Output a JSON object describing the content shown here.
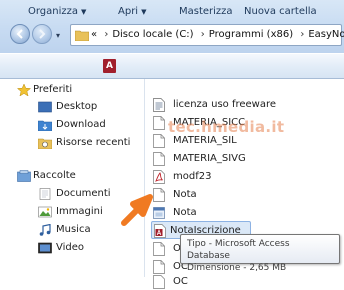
{
  "address": {
    "chevrons": "«",
    "crumbs": [
      "Disco locale (C:)",
      "Programmi (x86)",
      "EasyNota"
    ],
    "separator": "›"
  },
  "toolbar": {
    "organizza": "Organizza",
    "apri": "Apri",
    "masterizza": "Masterizza",
    "nuova_cartella": "Nuova cartella"
  },
  "nav": {
    "favorites_header": "Preferiti",
    "favorites": [
      "Desktop",
      "Download",
      "Risorse recenti"
    ],
    "libraries_header": "Raccolte",
    "libraries": [
      "Documenti",
      "Immagini",
      "Musica",
      "Video"
    ]
  },
  "files": [
    {
      "name": "licenza uso freeware",
      "icon": "text-file-icon"
    },
    {
      "name": "MATERIA_SICC",
      "icon": "document-icon"
    },
    {
      "name": "MATERIA_SIL",
      "icon": "document-icon"
    },
    {
      "name": "MATERIA_SIVG",
      "icon": "document-icon"
    },
    {
      "name": "modf23",
      "icon": "pdf-icon"
    },
    {
      "name": "Nota",
      "icon": "document-icon"
    },
    {
      "name": "Nota",
      "icon": "application-icon"
    },
    {
      "name": "NotaIscrizione",
      "icon": "access-database-icon",
      "selected": true
    },
    {
      "name": "OC",
      "icon": "document-icon"
    },
    {
      "name": "OC",
      "icon": "document-icon"
    },
    {
      "name": "OC",
      "icon": "document-icon"
    }
  ],
  "watermark": "tec.hmedia.it",
  "tooltip": {
    "type_line": "Tipo - Microsoft Access Database",
    "size_line": "Dimensione - 2,65 MB"
  },
  "colors": {
    "accent_arrow": "#f07a22",
    "selection": "#dbe8f7",
    "access_red": "#a11f2c"
  }
}
